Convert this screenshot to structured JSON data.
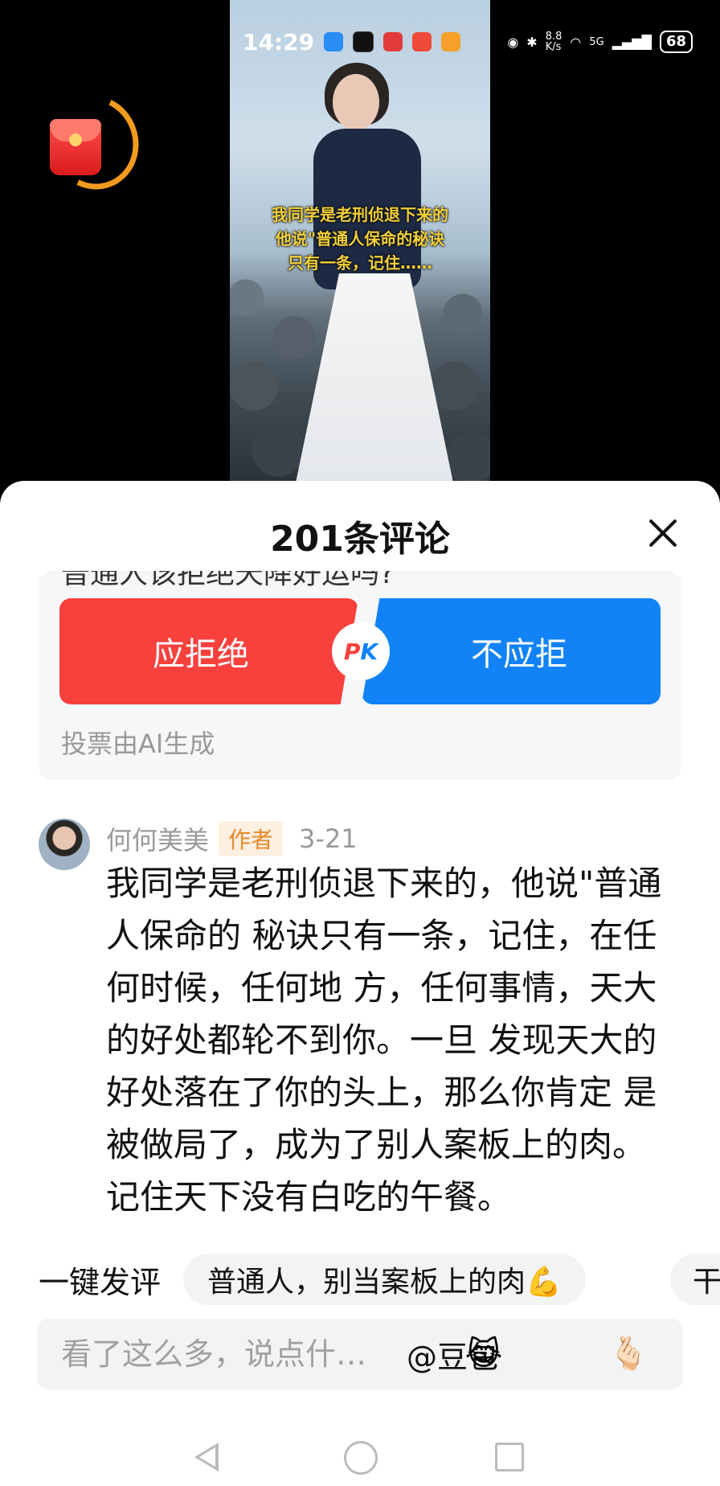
{
  "status_bar": {
    "time": "14:29",
    "net_speed": "8.8\nK/s",
    "network": "5G",
    "battery": "68"
  },
  "video": {
    "caption_lines": [
      "我同学是老刑侦退下来的",
      "他说\"普通人保命的秘诀",
      "只有一条，记住……"
    ]
  },
  "sheet": {
    "title": "201条评论",
    "close_icon": "close-icon"
  },
  "vote": {
    "question_cut": "普通人该拒绝天降好运吗?",
    "left_label": "应拒绝",
    "right_label": "不应拒",
    "pk_p": "P",
    "pk_k": "K",
    "note": "投票由AI生成",
    "left_color": "#f8413d",
    "right_color": "#1183f7"
  },
  "comment": {
    "author": "何何美美",
    "author_tag": "作者",
    "date": "3-21",
    "text": "我同学是老刑侦退下来的，他说\"普通人保命的 秘诀只有一条，记住，在任何时候，任何地 方，任何事情，天大的好处都轮不到你。一旦 发现天大的好处落在了你的头上，那么你肯定 是被做局了，成为了别人案板上的肉。 记住天下没有白吃的午餐。"
  },
  "quick_comment": {
    "label": "一键发评",
    "chip1": "普通人，别当案板上的肉💪",
    "chip2": "干"
  },
  "input": {
    "placeholder": "看了这么多，说点什…",
    "mention": "@豆包",
    "emoji1": "😹",
    "emoji2": "🫰🏻"
  }
}
